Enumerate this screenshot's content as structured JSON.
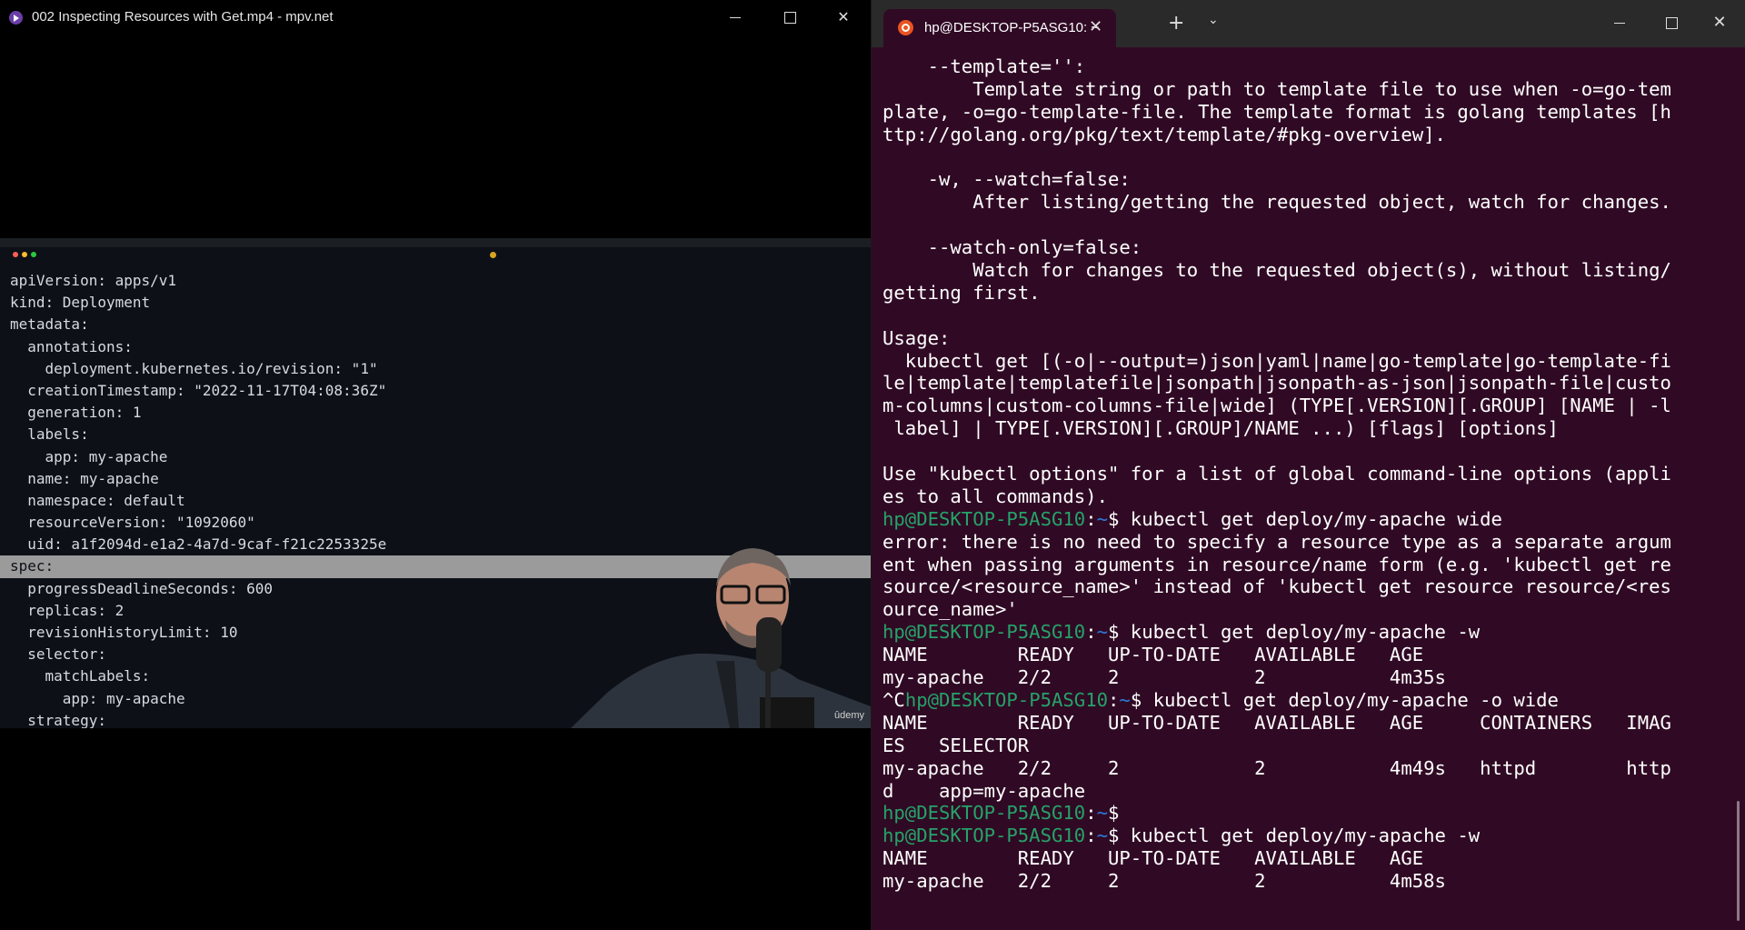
{
  "mpv": {
    "title": "002 Inspecting Resources with Get.mp4 - mpv.net",
    "controls": {
      "minimize": "minimize",
      "maximize": "maximize",
      "close": "close"
    }
  },
  "video": {
    "yaml_lines": [
      "apiVersion: apps/v1",
      "kind: Deployment",
      "metadata:",
      "  annotations:",
      "    deployment.kubernetes.io/revision: \"1\"",
      "  creationTimestamp: \"2022-11-17T04:08:36Z\"",
      "  generation: 1",
      "  labels:",
      "    app: my-apache",
      "  name: my-apache",
      "  namespace: default",
      "  resourceVersion: \"1092060\"",
      "  uid: a1f2094d-e1a2-4a7d-9caf-f21c2253325e",
      "spec:",
      "  progressDeadlineSeconds: 600",
      "  replicas: 2",
      "  revisionHistoryLimit: 10",
      "  selector:",
      "    matchLabels:",
      "      app: my-apache",
      "  strategy:"
    ],
    "highlighted_index": 13,
    "watermark": "ûdemy"
  },
  "terminal": {
    "tab_title": "hp@DESKTOP-P5ASG10: ~",
    "new_tab": "+",
    "dropdown": "⌄",
    "prompt_user": "hp@DESKTOP-P5ASG10",
    "prompt_path": "~",
    "lines": [
      {
        "t": "    --template='':"
      },
      {
        "t": "        Template string or path to template file to use when -o=go-tem"
      },
      {
        "t": "plate, -o=go-template-file. The template format is golang templates [h"
      },
      {
        "t": "ttp://golang.org/pkg/text/template/#pkg-overview]."
      },
      {
        "t": ""
      },
      {
        "t": "    -w, --watch=false:"
      },
      {
        "t": "        After listing/getting the requested object, watch for changes."
      },
      {
        "t": ""
      },
      {
        "t": "    --watch-only=false:"
      },
      {
        "t": "        Watch for changes to the requested object(s), without listing/"
      },
      {
        "t": "getting first."
      },
      {
        "t": ""
      },
      {
        "t": "Usage:"
      },
      {
        "t": "  kubectl get [(-o|--output=)json|yaml|name|go-template|go-template-fi"
      },
      {
        "t": "le|template|templatefile|jsonpath|jsonpath-as-json|jsonpath-file|custo"
      },
      {
        "t": "m-columns|custom-columns-file|wide] (TYPE[.VERSION][.GROUP] [NAME | -l"
      },
      {
        "t": " label] | TYPE[.VERSION][.GROUP]/NAME ...) [flags] [options]"
      },
      {
        "t": ""
      },
      {
        "t": "Use \"kubectl options\" for a list of global command-line options (appli"
      },
      {
        "t": "es to all commands)."
      },
      {
        "p": "",
        "t": "$ kubectl get deploy/my-apache wide"
      },
      {
        "t": "error: there is no need to specify a resource type as a separate argum"
      },
      {
        "t": "ent when passing arguments in resource/name form (e.g. 'kubectl get re"
      },
      {
        "t": "source/<resource_name>' instead of 'kubectl get resource resource/<res"
      },
      {
        "t": "ource_name>'"
      },
      {
        "p": "",
        "t": "$ kubectl get deploy/my-apache -w"
      },
      {
        "t": "NAME        READY   UP-TO-DATE   AVAILABLE   AGE"
      },
      {
        "t": "my-apache   2/2     2            2           4m35s"
      },
      {
        "p": "^C",
        "t": "$ kubectl get deploy/my-apache -o wide"
      },
      {
        "t": "NAME        READY   UP-TO-DATE   AVAILABLE   AGE     CONTAINERS   IMAG"
      },
      {
        "t": "ES   SELECTOR"
      },
      {
        "t": "my-apache   2/2     2            2           4m49s   httpd        http"
      },
      {
        "t": "d    app=my-apache"
      },
      {
        "p": "",
        "t": "$"
      },
      {
        "p": "",
        "t": "$ kubectl get deploy/my-apache -w"
      },
      {
        "t": "NAME        READY   UP-TO-DATE   AVAILABLE   AGE"
      },
      {
        "t": "my-apache   2/2     2            2           4m58s"
      }
    ]
  }
}
